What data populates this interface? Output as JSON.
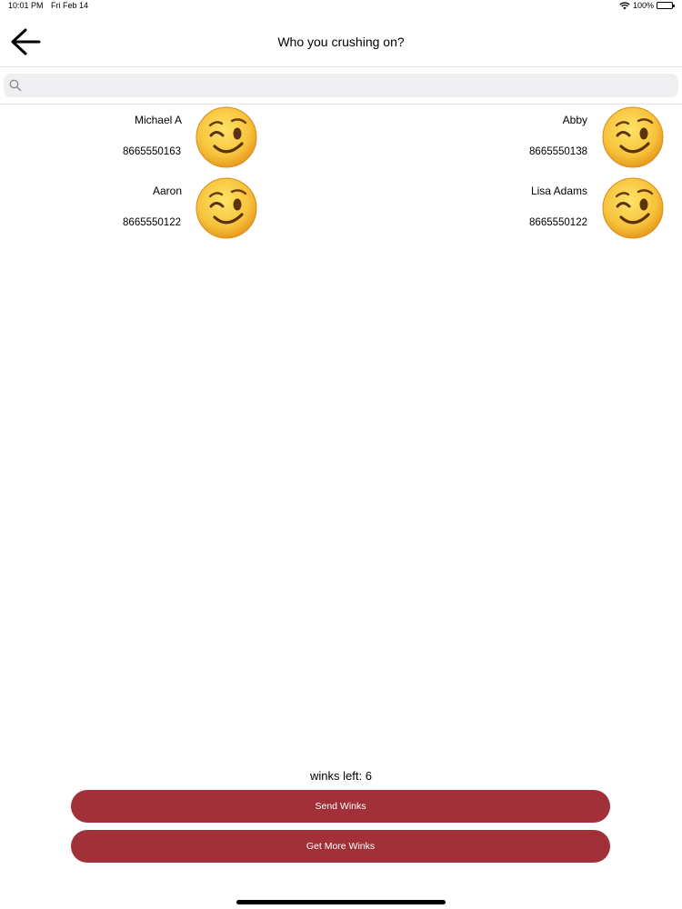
{
  "status": {
    "time": "10:01 PM",
    "date": "Fri Feb 14",
    "battery": "100%"
  },
  "nav": {
    "title": "Who you crushing on?"
  },
  "search": {
    "placeholder": "",
    "value": ""
  },
  "contacts": [
    {
      "name": "Michael A",
      "phone": "8665550163",
      "icon": "winking-face-icon"
    },
    {
      "name": "Abby",
      "phone": "8665550138",
      "icon": "winking-face-icon"
    },
    {
      "name": "Aaron",
      "phone": "8665550122",
      "icon": "winking-face-icon"
    },
    {
      "name": "Lisa Adams",
      "phone": "8665550122",
      "icon": "winking-face-icon"
    }
  ],
  "footer": {
    "winks_left": "winks left: 6",
    "send_label": "Send Winks",
    "more_label": "Get More Winks"
  },
  "colors": {
    "accent": "#a23038",
    "emoji": "#f7c23c"
  }
}
